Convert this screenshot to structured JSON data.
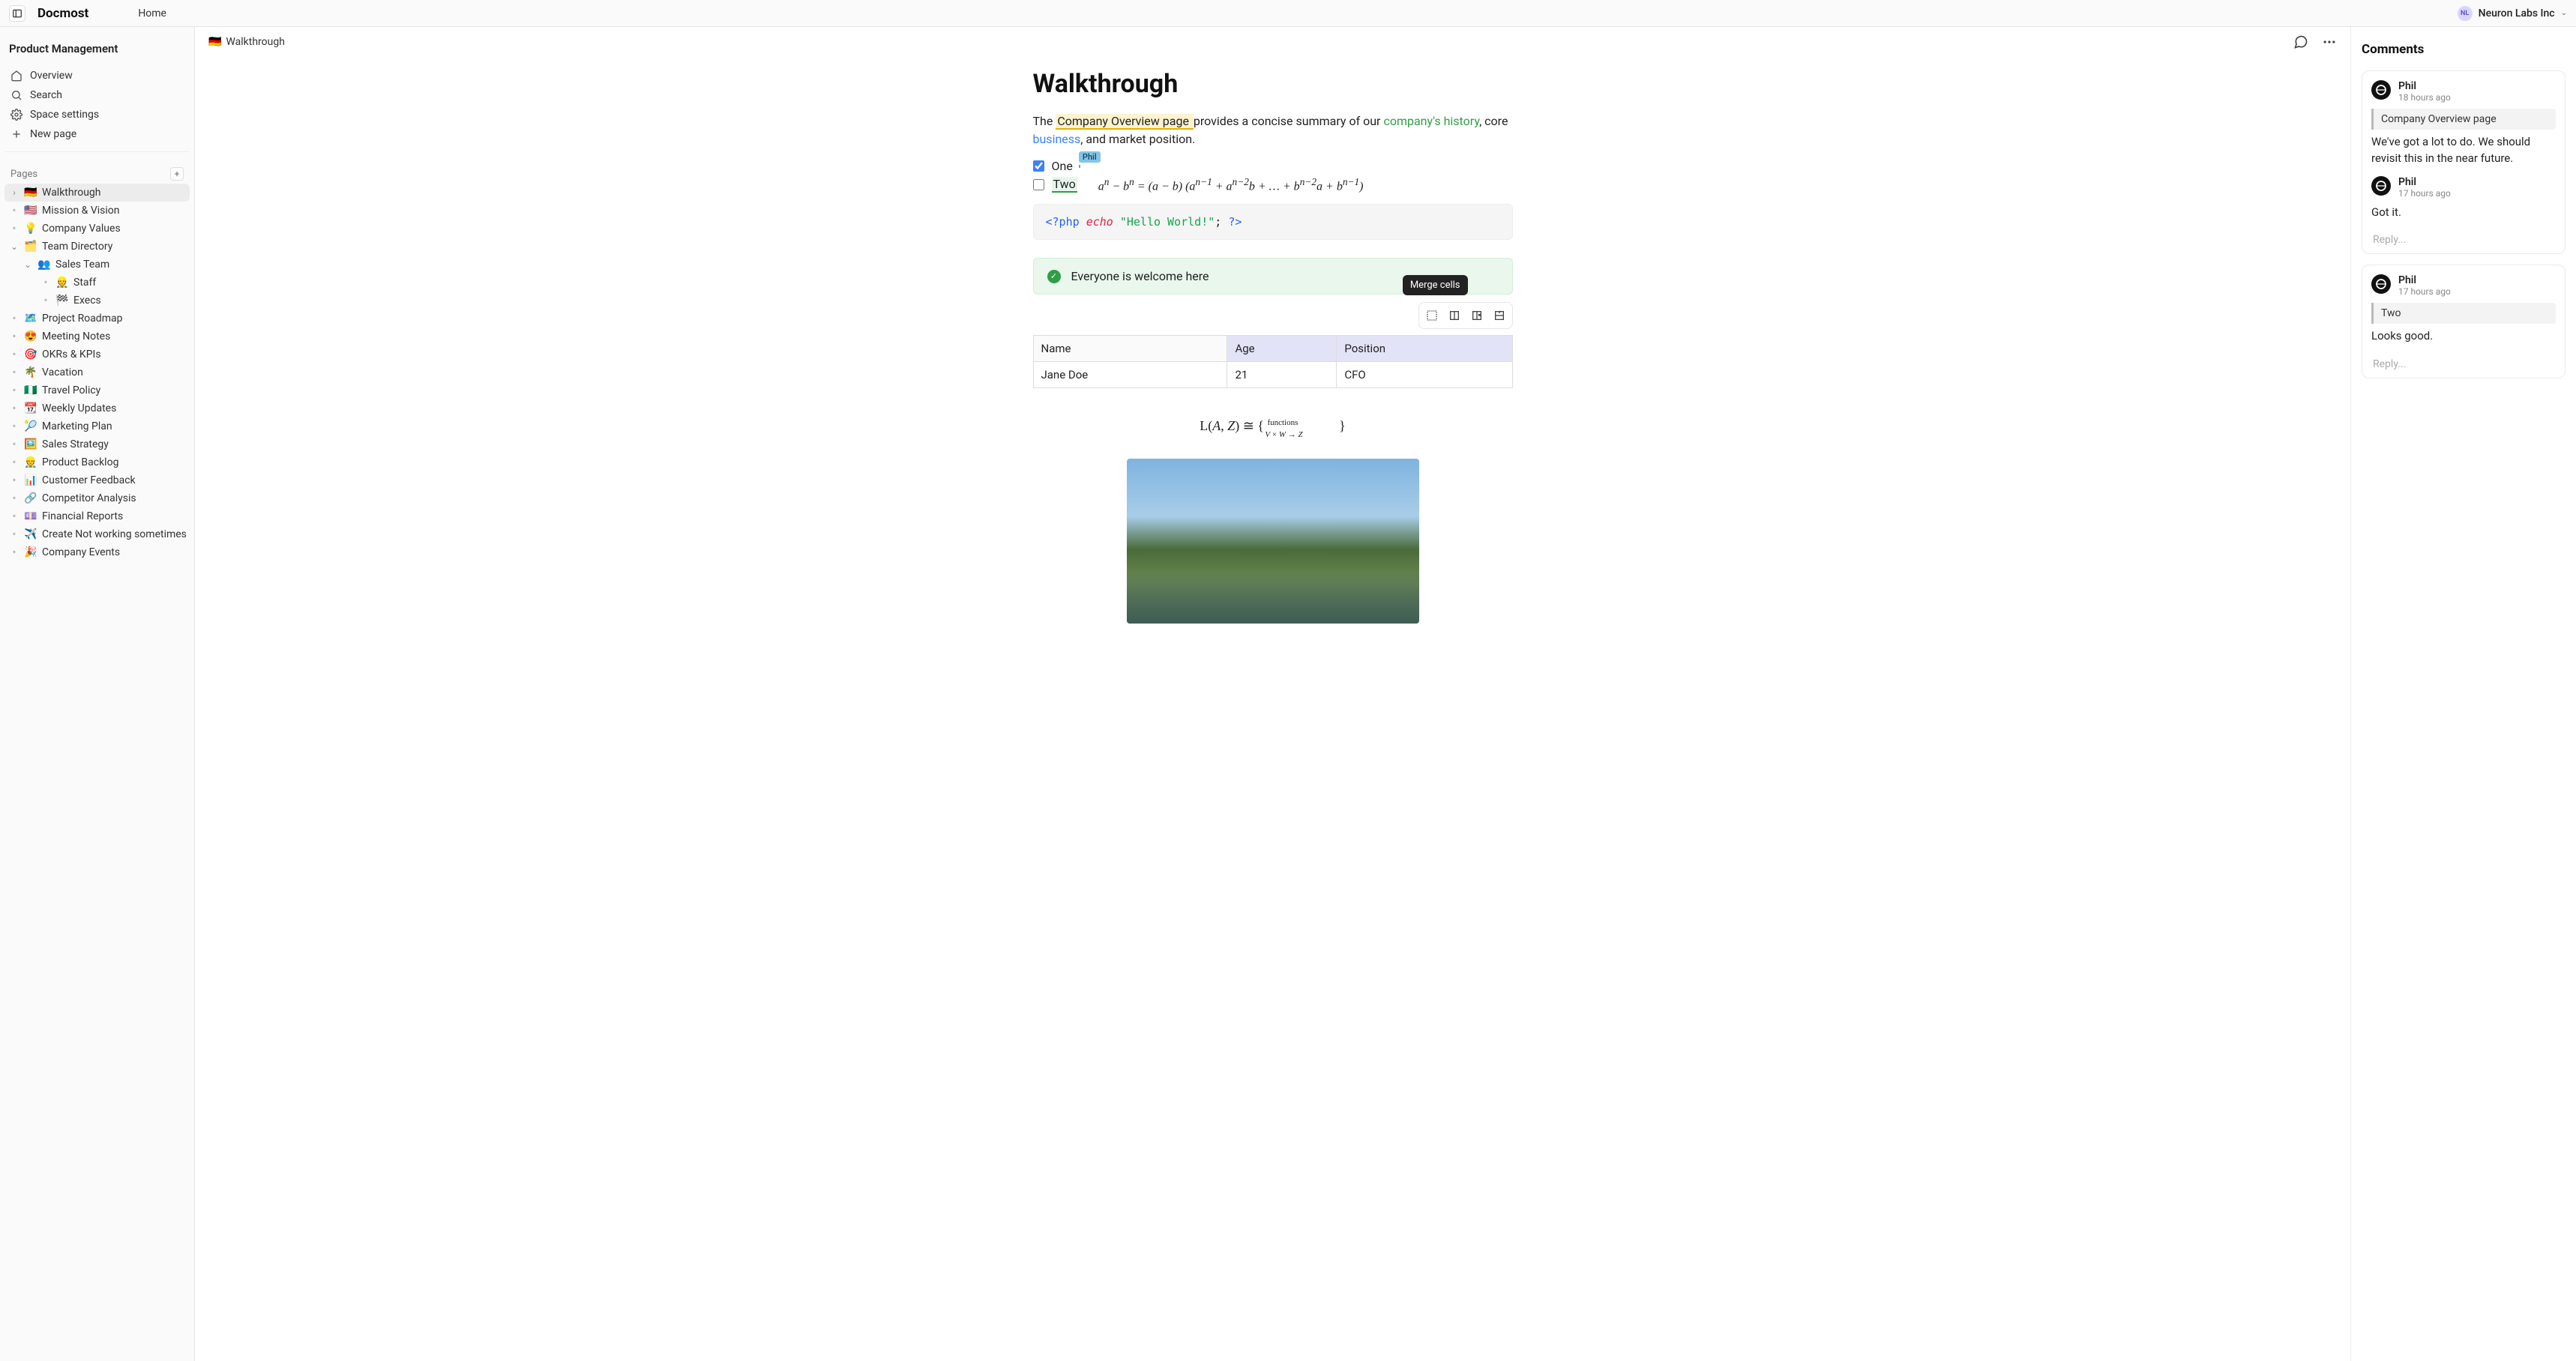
{
  "topbar": {
    "brand": "Docmost",
    "home": "Home",
    "org_initials": "NL",
    "org_name": "Neuron Labs Inc"
  },
  "sidebar": {
    "space": "Product Management",
    "overview": "Overview",
    "search": "Search",
    "settings": "Space settings",
    "newpage": "New page",
    "pages_label": "Pages",
    "tree": [
      {
        "emoji": "🇩🇪",
        "label": "Walkthrough",
        "caret": "›",
        "active": true,
        "indent": 0
      },
      {
        "emoji": "🇺🇸",
        "label": "Mission & Vision",
        "bullet": true,
        "indent": 0
      },
      {
        "emoji": "💡",
        "label": "Company Values",
        "bullet": true,
        "indent": 0
      },
      {
        "emoji": "🗂️",
        "label": "Team Directory",
        "caret": "⌄",
        "indent": 0
      },
      {
        "emoji": "👥",
        "label": "Sales Team",
        "caret": "⌄",
        "indent": 1
      },
      {
        "emoji": "👷",
        "label": "Staff",
        "bullet": true,
        "indent": 2
      },
      {
        "emoji": "🏁",
        "label": "Execs",
        "bullet": true,
        "indent": 2
      },
      {
        "emoji": "🗺️",
        "label": "Project Roadmap",
        "bullet": true,
        "indent": 0
      },
      {
        "emoji": "😍",
        "label": "Meeting Notes",
        "bullet": true,
        "indent": 0
      },
      {
        "emoji": "🎯",
        "label": "OKRs & KPIs",
        "bullet": true,
        "indent": 0
      },
      {
        "emoji": "🌴",
        "label": "Vacation",
        "bullet": true,
        "indent": 0
      },
      {
        "emoji": "🇳🇬",
        "label": "Travel Policy",
        "bullet": true,
        "indent": 0
      },
      {
        "emoji": "📆",
        "label": "Weekly Updates",
        "bullet": true,
        "indent": 0
      },
      {
        "emoji": "🎾",
        "label": "Marketing Plan",
        "bullet": true,
        "indent": 0
      },
      {
        "emoji": "🖼️",
        "label": "Sales Strategy",
        "bullet": true,
        "indent": 0
      },
      {
        "emoji": "👷",
        "label": "Product Backlog",
        "bullet": true,
        "indent": 0
      },
      {
        "emoji": "📊",
        "label": "Customer Feedback",
        "bullet": true,
        "indent": 0
      },
      {
        "emoji": "🔗",
        "label": "Competitor Analysis",
        "bullet": true,
        "indent": 0
      },
      {
        "emoji": "💷",
        "label": "Financial Reports",
        "bullet": true,
        "indent": 0
      },
      {
        "emoji": "✈️",
        "label": "Create Not working sometimes",
        "bullet": true,
        "indent": 0
      },
      {
        "emoji": "🎉",
        "label": "Company Events",
        "bullet": true,
        "indent": 0
      }
    ]
  },
  "doc": {
    "breadcrumb_emoji": "🇩🇪",
    "breadcrumb_label": "Walkthrough",
    "title": "Walkthrough",
    "para_pre": "The ",
    "para_hl": "Company Overview page ",
    "para_mid1": "provides a concise summary of our ",
    "para_history": "company's history",
    "para_mid2": ", core ",
    "para_business": "business",
    "para_end": ", and market position.",
    "cursor_name": "Phil",
    "check1": "One",
    "check2": "Two",
    "math_inline_html": "a<sup>n</sup> − b<sup>n</sup> = (a − b) (a<sup>n−1</sup> + a<sup>n−2</sup>b + … + b<sup>n−2</sup>a + b<sup>n−1</sup>)",
    "code_html": "<span class='tok-tag'>&lt;?php</span> <span class='tok-echo'>echo</span> <span class='tok-str'>\"Hello World!\"</span>; <span class='tok-tag'>?&gt;</span>",
    "callout": "Everyone is welcome here",
    "tooltip": "Merge cells",
    "table": {
      "h1": "Name",
      "h2": "Age",
      "h3": "Position",
      "c1": "Jane Doe",
      "c2": "21",
      "c3": "CFO"
    },
    "math_block_html": "L(<i>A</i>, <i>Z</i>) ≅ { <sup style='font-size:11px'>functions</sup><sub style='font-size:11px; position:relative; left:-44px; top:4px;'><i>V</i> × <i>W</i> → <i>Z</i></sub> }"
  },
  "comments": {
    "title": "Comments",
    "reply_ph": "Reply...",
    "threads": [
      {
        "quote": "Company Overview page",
        "body_top": "We've got a lot to do. We should revisit this in the near future.",
        "msgs": [
          {
            "name": "Phil",
            "time": "18 hours ago"
          },
          {
            "name": "Phil",
            "time": "17 hours ago",
            "body": "Got it."
          }
        ]
      },
      {
        "quote": "Two",
        "msgs": [
          {
            "name": "Phil",
            "time": "17 hours ago"
          }
        ],
        "body_top": "Looks good."
      }
    ]
  }
}
